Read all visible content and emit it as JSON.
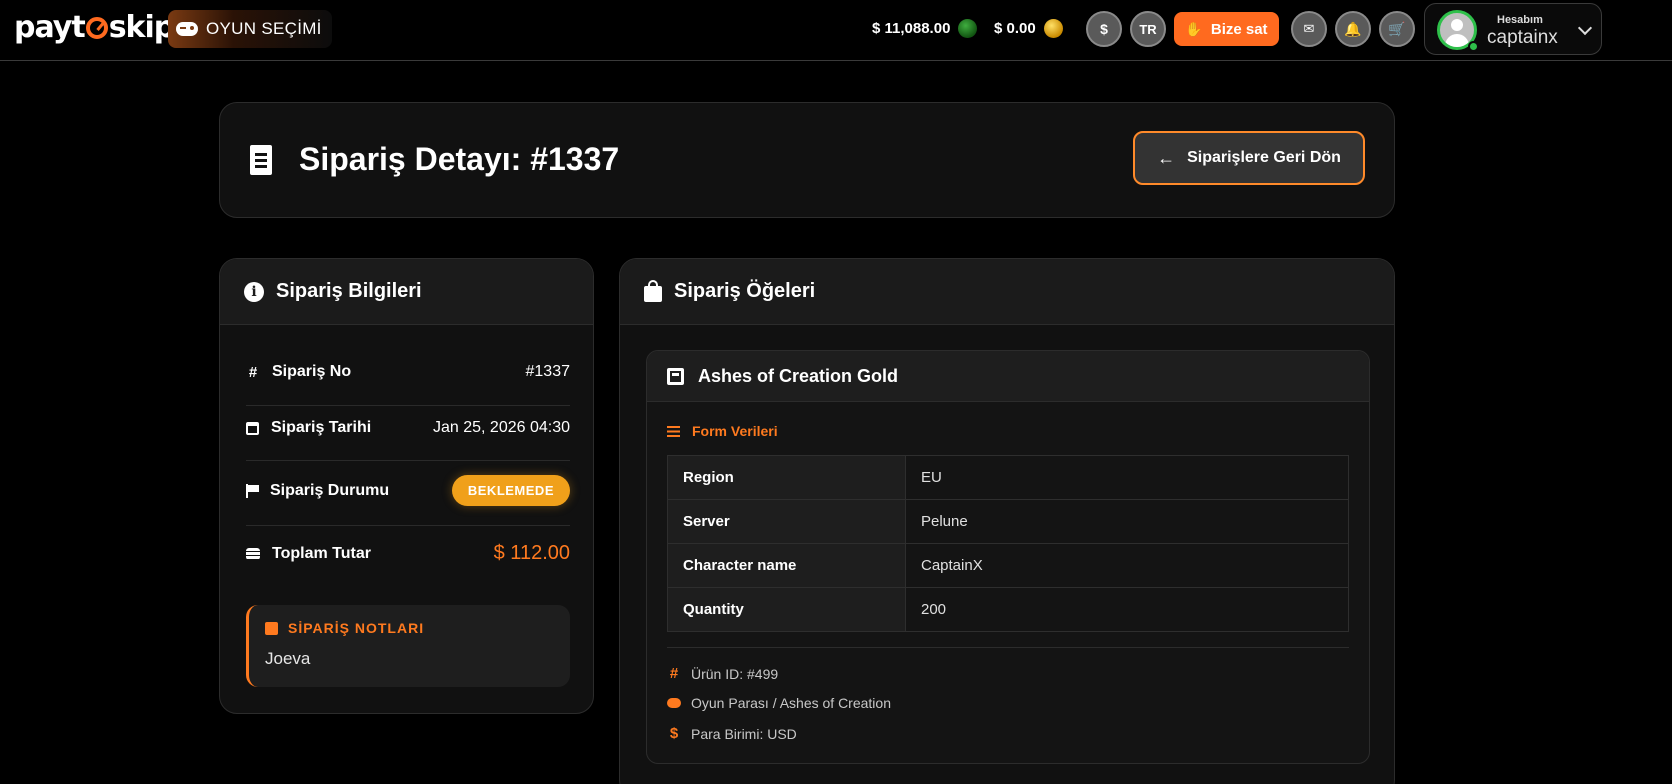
{
  "header": {
    "logo_text": "paytoskip",
    "logo_left": "payt",
    "logo_right": "skip",
    "game_select_label": "OYUN SEÇİMİ",
    "balance_primary": "$ 11,088.00",
    "balance_secondary": "$ 0.00",
    "currency_button": "$",
    "language_button": "TR",
    "sell_button": "Bize sat",
    "account_label": "Hesabım",
    "username": "captainx"
  },
  "title_card": {
    "title": "Sipariş Detayı: #1337",
    "back_button": "Siparişlere Geri Dön"
  },
  "order_info": {
    "heading": "Sipariş Bilgileri",
    "order_no_label": "Sipariş No",
    "order_no_value": "#1337",
    "order_date_label": "Sipariş Tarihi",
    "order_date_value": "Jan 25, 2026 04:30",
    "status_label": "Sipariş Durumu",
    "status_value": "BEKLEMEDE",
    "total_label": "Toplam Tutar",
    "total_value": "$ 112.00",
    "notes_heading": "SİPARİŞ NOTLARI",
    "notes_text": "Joeva"
  },
  "order_items": {
    "heading": "Sipariş Öğeleri",
    "item_title": "Ashes of Creation Gold",
    "form_heading": "Form Verileri",
    "form_rows": [
      {
        "key": "Region",
        "value": "EU"
      },
      {
        "key": "Server",
        "value": "Pelune"
      },
      {
        "key": "Character name",
        "value": "CaptainX"
      },
      {
        "key": "Quantity",
        "value": "200"
      }
    ],
    "product_id": "Ürün ID: #499",
    "category": "Oyun Parası / Ashes of Creation",
    "currency": "Para Birimi: USD"
  },
  "colors": {
    "accent": "#ff7a1f",
    "status_badge": "#f0a01a",
    "online": "#2ec04a"
  }
}
